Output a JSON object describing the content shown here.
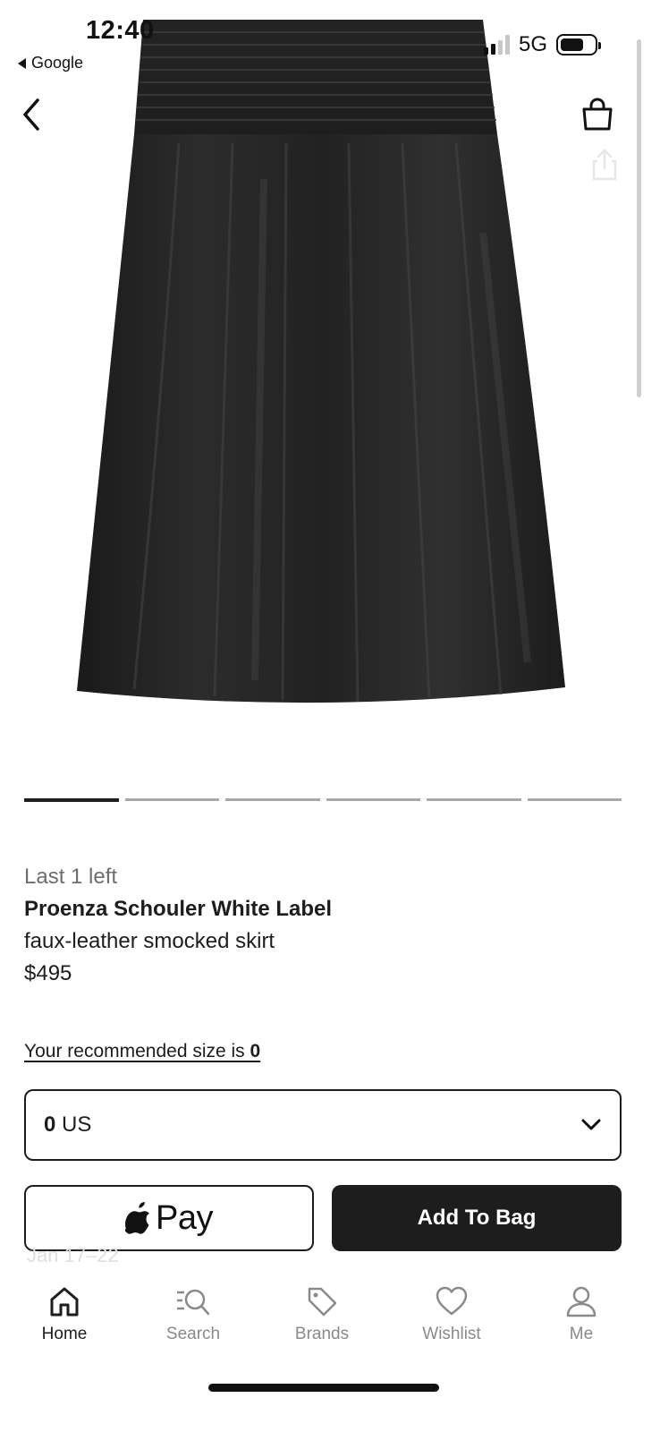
{
  "status_bar": {
    "time": "12:40",
    "back_app": "Google",
    "network": "5G"
  },
  "product_image": {
    "alt": "Black faux-leather smocked skirt",
    "pager_count": 6,
    "pager_active_index": 0
  },
  "product": {
    "stock": "Last 1 left",
    "brand": "Proenza Schouler White Label",
    "name": "faux-leather smocked skirt",
    "price": "$495"
  },
  "size": {
    "recommended_prefix": "Your recommended size is ",
    "recommended_value": "0",
    "selected_size": "0",
    "selected_region": " US"
  },
  "actions": {
    "apple_pay_label": "Pay",
    "add_to_bag_label": "Add To Bag"
  },
  "delivery_text": "Jan 17–22",
  "tabbar": {
    "items": [
      {
        "label": "Home",
        "icon": "home-icon",
        "active": true
      },
      {
        "label": "Search",
        "icon": "search-icon",
        "active": false
      },
      {
        "label": "Brands",
        "icon": "tag-icon",
        "active": false
      },
      {
        "label": "Wishlist",
        "icon": "heart-icon",
        "active": false
      },
      {
        "label": "Me",
        "icon": "user-icon",
        "active": false
      }
    ]
  },
  "colors": {
    "primary": "#1d1d1d",
    "muted": "#8a8a8a",
    "background": "#ffffff"
  }
}
